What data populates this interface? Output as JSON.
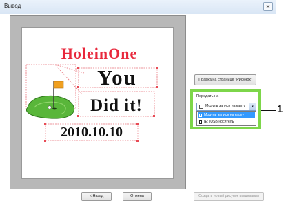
{
  "window": {
    "title": "Вывод",
    "close_glyph": "✕"
  },
  "canvas": {
    "texts": [
      "HoleinOne",
      "You",
      "Did it!",
      "2010.10.10"
    ],
    "colors": {
      "title_red": "#e8283c",
      "text_black": "#111111",
      "selection_pink": "#e8737b",
      "grass_green": "#59b63a",
      "flag_orange": "#f0a020"
    },
    "image_icon": "golf-flag-green-icon"
  },
  "side_panel": {
    "edit_button_label": "Правка на странице \"Рисунок\"",
    "export_label": "Передать на",
    "dropdown": {
      "selected_value": "Модуль записи на карту",
      "arrow_glyph": "▾",
      "options": [
        {
          "label": "Модуль записи на карту",
          "icon": "card-writer-icon",
          "selected": true
        },
        {
          "label": "[E:] USB носитель",
          "icon": "usb-drive-icon",
          "selected": false
        }
      ]
    },
    "accent_color": "#7dd64a"
  },
  "callout": {
    "number": "1"
  },
  "footer": {
    "back_label": "< Назад",
    "cancel_label": "Отмена",
    "create_label": "Создать новый рисунок вышивания"
  }
}
